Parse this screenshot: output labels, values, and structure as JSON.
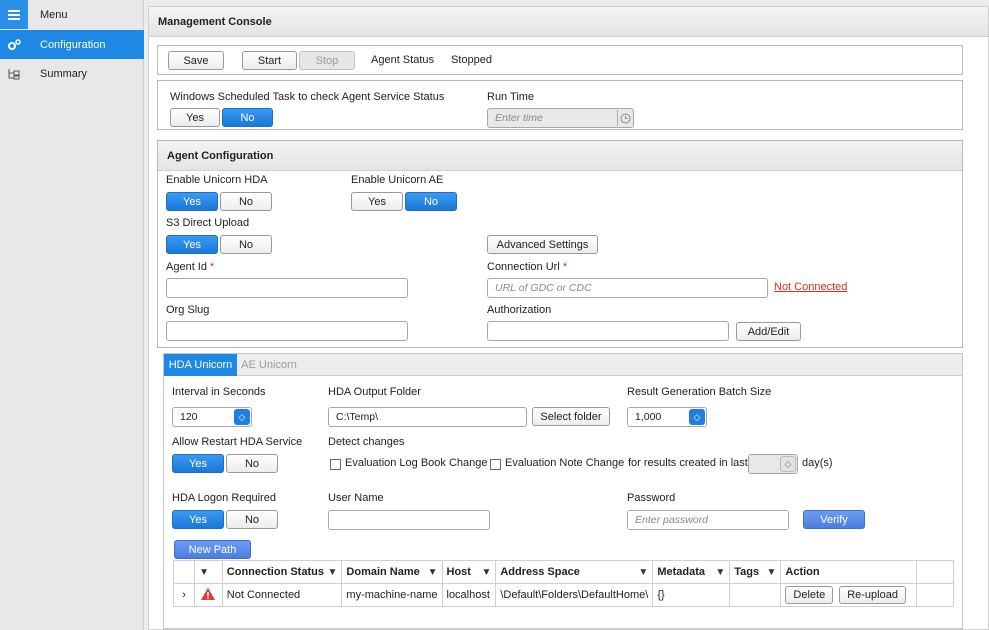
{
  "sidebar": {
    "items": [
      {
        "label": "Menu",
        "icon": "hamburger-icon"
      },
      {
        "label": "Configuration",
        "icon": "gears-icon"
      },
      {
        "label": "Summary",
        "icon": "tree-icon"
      }
    ]
  },
  "console": {
    "title": "Management Console",
    "save_label": "Save",
    "start_label": "Start",
    "stop_label": "Stop",
    "agent_status_label": "Agent Status",
    "agent_status_value": "Stopped",
    "scheduled_task_label": "Windows Scheduled Task to check Agent Service Status",
    "yes_label": "Yes",
    "no_label": "No",
    "run_time_label": "Run Time",
    "run_time_placeholder": "Enter time"
  },
  "agent_config": {
    "title": "Agent Configuration",
    "enable_hda_label": "Enable Unicorn HDA",
    "enable_ae_label": "Enable Unicorn AE",
    "s3_label": "S3 Direct Upload",
    "advanced_settings_label": "Advanced Settings",
    "agent_id_label": "Agent Id",
    "required_mark": "*",
    "connection_url_label": "Connection Url",
    "connection_url_placeholder": "URL of GDC or CDC",
    "not_connected_label": "Not Connected",
    "org_slug_label": "Org Slug",
    "authorization_label": "Authorization",
    "add_edit_label": "Add/Edit"
  },
  "tabs": [
    {
      "label": "HDA Unicorn",
      "active": true
    },
    {
      "label": "AE Unicorn",
      "active": false
    }
  ],
  "hda": {
    "interval_label": "Interval in Seconds",
    "interval_value": "120",
    "output_folder_label": "HDA Output Folder",
    "output_folder_value": "C:\\Temp\\",
    "select_folder_label": "Select folder",
    "batch_size_label": "Result Generation Batch Size",
    "batch_size_value": "1,000",
    "allow_restart_label": "Allow Restart HDA Service",
    "detect_changes_label": "Detect changes",
    "eval_logbook_label": "Evaluation Log Book Change",
    "eval_note_label": "Evaluation Note Change",
    "results_created_label": "for results created in last",
    "days_label": "day(s)",
    "logon_required_label": "HDA Logon Required",
    "username_label": "User Name",
    "password_label": "Password",
    "password_placeholder": "Enter password",
    "verify_label": "Verify",
    "new_path_label": "New Path"
  },
  "table": {
    "columns": [
      "Connection Status",
      "Domain Name",
      "Host",
      "Address Space",
      "Metadata",
      "Tags",
      "Action"
    ],
    "rows": [
      {
        "status": "Not Connected",
        "domain": "my-machine-name",
        "host": "localhost",
        "address_space": "\\Default\\Folders\\DefaultHome\\",
        "metadata": "{}",
        "tags": "",
        "delete_label": "Delete",
        "reupload_label": "Re-upload"
      }
    ]
  },
  "colors": {
    "accent": "#1e88e5",
    "error": "#d93025",
    "warning": "#e53935"
  }
}
